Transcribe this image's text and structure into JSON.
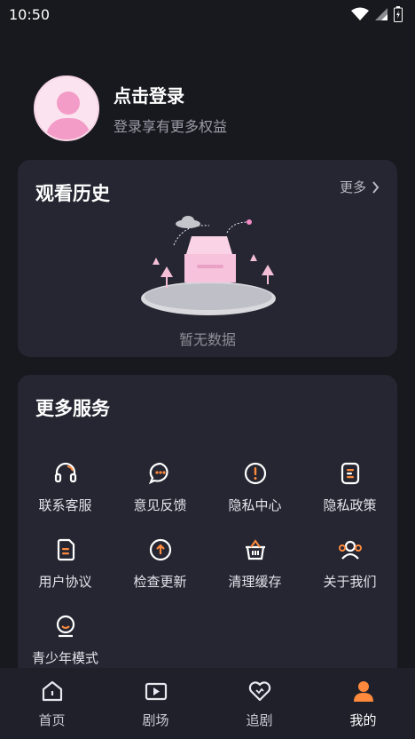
{
  "status_bar": {
    "time": "10:50"
  },
  "profile": {
    "login_title": "点击登录",
    "login_subtitle": "登录享有更多权益"
  },
  "history": {
    "title": "观看历史",
    "more_label": "更多",
    "empty_text": "暂无数据"
  },
  "services": {
    "title": "更多服务",
    "items": [
      {
        "label": "联系客服",
        "icon": "headset-icon"
      },
      {
        "label": "意见反馈",
        "icon": "feedback-chat-icon"
      },
      {
        "label": "隐私中心",
        "icon": "privacy-alert-icon"
      },
      {
        "label": "隐私政策",
        "icon": "policy-document-icon"
      },
      {
        "label": "用户协议",
        "icon": "agreement-document-icon"
      },
      {
        "label": "检查更新",
        "icon": "update-arrow-icon"
      },
      {
        "label": "清理缓存",
        "icon": "basket-icon"
      },
      {
        "label": "关于我们",
        "icon": "team-icon"
      },
      {
        "label": "青少年模式",
        "icon": "teen-mode-icon"
      }
    ]
  },
  "tabbar": {
    "items": [
      {
        "label": "首页",
        "icon": "home-icon"
      },
      {
        "label": "剧场",
        "icon": "theater-play-icon"
      },
      {
        "label": "追剧",
        "icon": "heart-icon"
      },
      {
        "label": "我的",
        "icon": "profile-icon",
        "active": true
      }
    ]
  },
  "colors": {
    "background": "#18191f",
    "card": "#252631",
    "accent": "#ff8a3d",
    "tab_bar": "#1f2029"
  }
}
